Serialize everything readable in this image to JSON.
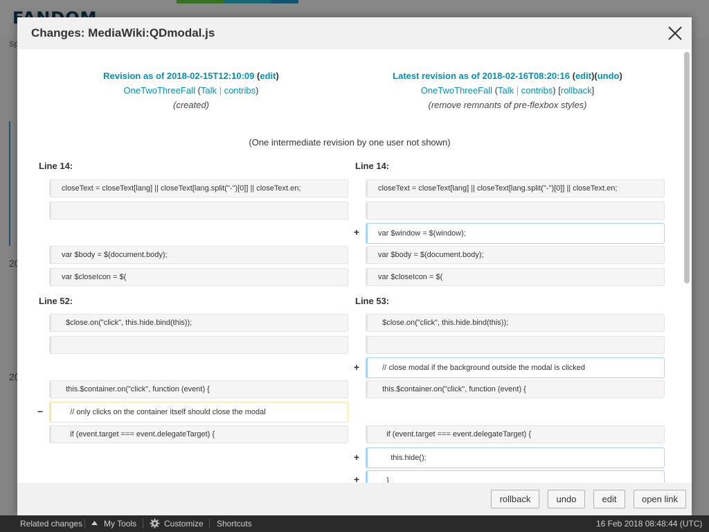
{
  "background": {
    "logo": "FANDOM",
    "side_fragments": [
      "Sp",
      "20",
      "20"
    ]
  },
  "modal": {
    "title": "Changes: MediaWiki:QDmodal.js",
    "old": {
      "title": "Revision as of 2018-02-15T12:10:09",
      "edit_link": "edit",
      "user": "OneTwoThreeFall",
      "talk": "Talk",
      "contribs": "contribs",
      "summary": "(created)"
    },
    "new": {
      "title": "Latest revision as of 2018-02-16T08:20:16",
      "edit_link": "edit",
      "undo_link": "undo",
      "user": "OneTwoThreeFall",
      "talk": "Talk",
      "contribs": "contribs",
      "rollback": "rollback",
      "summary": "(remove remnants of pre-flexbox styles)"
    },
    "intermediate": "(One intermediate revision by one user not shown)",
    "diff": {
      "hunk1": {
        "left_line": "Line 14:",
        "right_line": "Line 14:",
        "rows": [
          {
            "left": "closeText = closeText[lang] || closeText[lang.split(\"-\")[0]] || closeText.en;",
            "right": "closeText = closeText[lang] || closeText[lang.split(\"-\")[0]] || closeText.en;"
          },
          {
            "left": "",
            "right": ""
          },
          {
            "right_added": "var $window = $(window);"
          },
          {
            "left": "var $body = $(document.body);",
            "right": "var $body = $(document.body);"
          },
          {
            "left": "var $closeIcon = $(",
            "right": "var $closeIcon = $("
          }
        ]
      },
      "hunk2": {
        "left_line": "Line 52:",
        "right_line": "Line 53:",
        "rows": [
          {
            "left": "  $close.on(\"click\", this.hide.bind(this));",
            "right": "  $close.on(\"click\", this.hide.bind(this));"
          },
          {
            "left": "",
            "right": ""
          },
          {
            "right_added": "  // close modal if the background outside the modal is clicked"
          },
          {
            "left": "  this.$container.on(\"click\", function (event) {",
            "right": "  this.$container.on(\"click\", function (event) {"
          },
          {
            "left_deleted": "    // only clicks on the container itself should close the modal"
          },
          {
            "left": "    if (event.target === event.delegateTarget) {",
            "right": "    if (event.target === event.delegateTarget) {"
          },
          {
            "right_added": "      this.hide();"
          },
          {
            "right_added": "    }"
          }
        ]
      },
      "plus": "+",
      "minus": "−"
    },
    "footer": {
      "rollback": "rollback",
      "undo": "undo",
      "edit": "edit",
      "open_link": "open link"
    }
  },
  "toolbar": {
    "related_changes": "Related changes",
    "my_tools": "My Tools",
    "customize": "Customize",
    "shortcuts": "Shortcuts",
    "timestamp": "16 Feb 2018 08:48:44 (UTC)"
  },
  "colors": {
    "link": "#0092b8",
    "added_border": "#a3d3ff",
    "deleted_border": "#ffe49c"
  }
}
